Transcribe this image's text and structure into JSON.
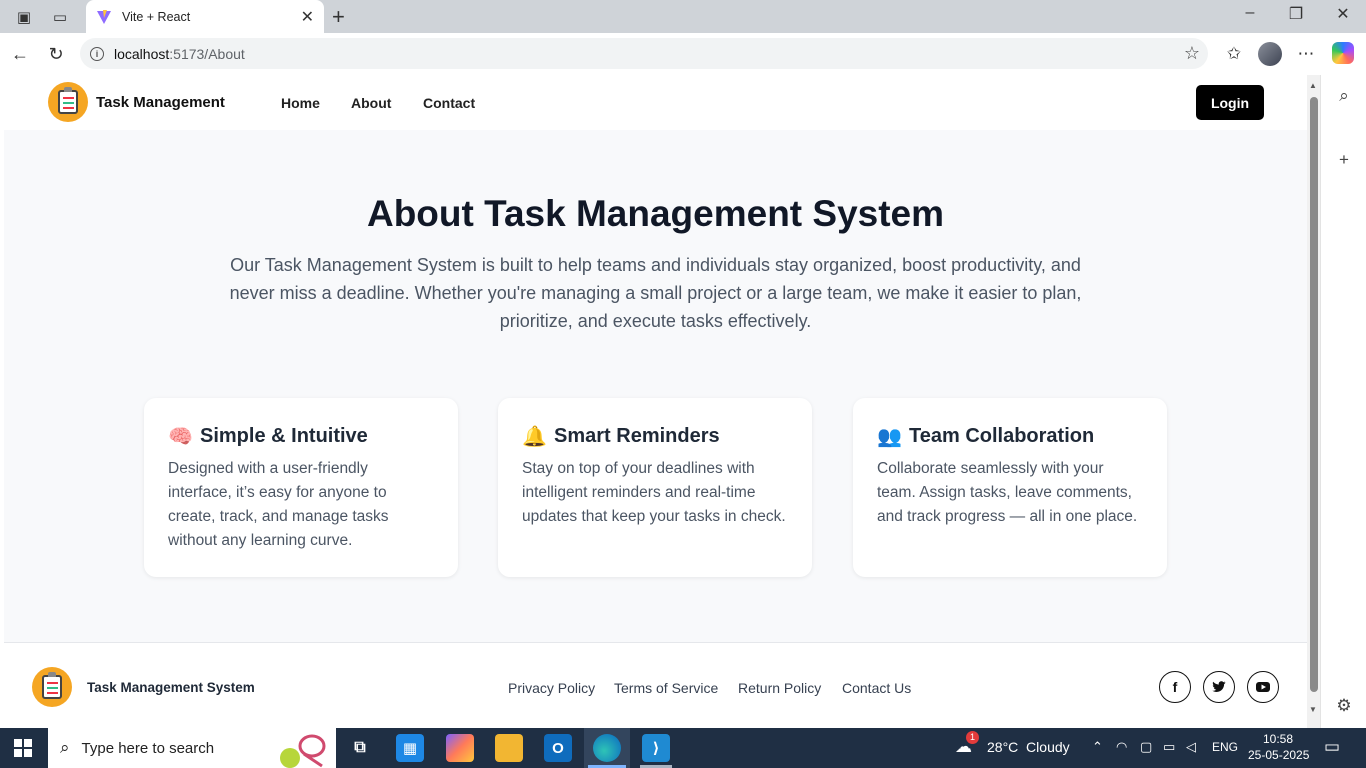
{
  "browser": {
    "tab_title": "Vite + React",
    "url_host": "localhost",
    "url_path": ":5173/About"
  },
  "site": {
    "brand": "Task Management",
    "nav": [
      "Home",
      "About",
      "Contact"
    ],
    "login_label": "Login"
  },
  "hero": {
    "title": "About Task Management System",
    "text": "Our Task Management System is built to help teams and individuals stay organized, boost productivity, and never miss a deadline. Whether you're managing a small project or a large team, we make it easier to plan, prioritize, and execute tasks effectively."
  },
  "cards": [
    {
      "icon": "brain-icon",
      "emoji": "🧠",
      "title": "Simple & Intuitive",
      "body": "Designed with a user-friendly interface, it’s easy for anyone to create, track, and manage tasks without any learning curve."
    },
    {
      "icon": "bell-icon",
      "emoji": "🔔",
      "title": "Smart Reminders",
      "body": "Stay on top of your deadlines with intelligent reminders and real-time updates that keep your tasks in check."
    },
    {
      "icon": "team-icon",
      "emoji": "👥",
      "title": "Team Collaboration",
      "body": "Collaborate seamlessly with your team. Assign tasks, leave comments, and track progress — all in one place."
    }
  ],
  "footer": {
    "brand": "Task Management System",
    "links": [
      "Privacy Policy",
      "Terms of Service",
      "Return Policy",
      "Contact Us"
    ],
    "social": [
      "facebook-icon",
      "twitter-icon",
      "youtube-icon"
    ]
  },
  "taskbar": {
    "search_placeholder": "Type here to search",
    "weather": "28°C  Cloudy",
    "weather_badge": "1",
    "lang": "ENG",
    "time": "10:58",
    "date": "25-05-2025"
  }
}
